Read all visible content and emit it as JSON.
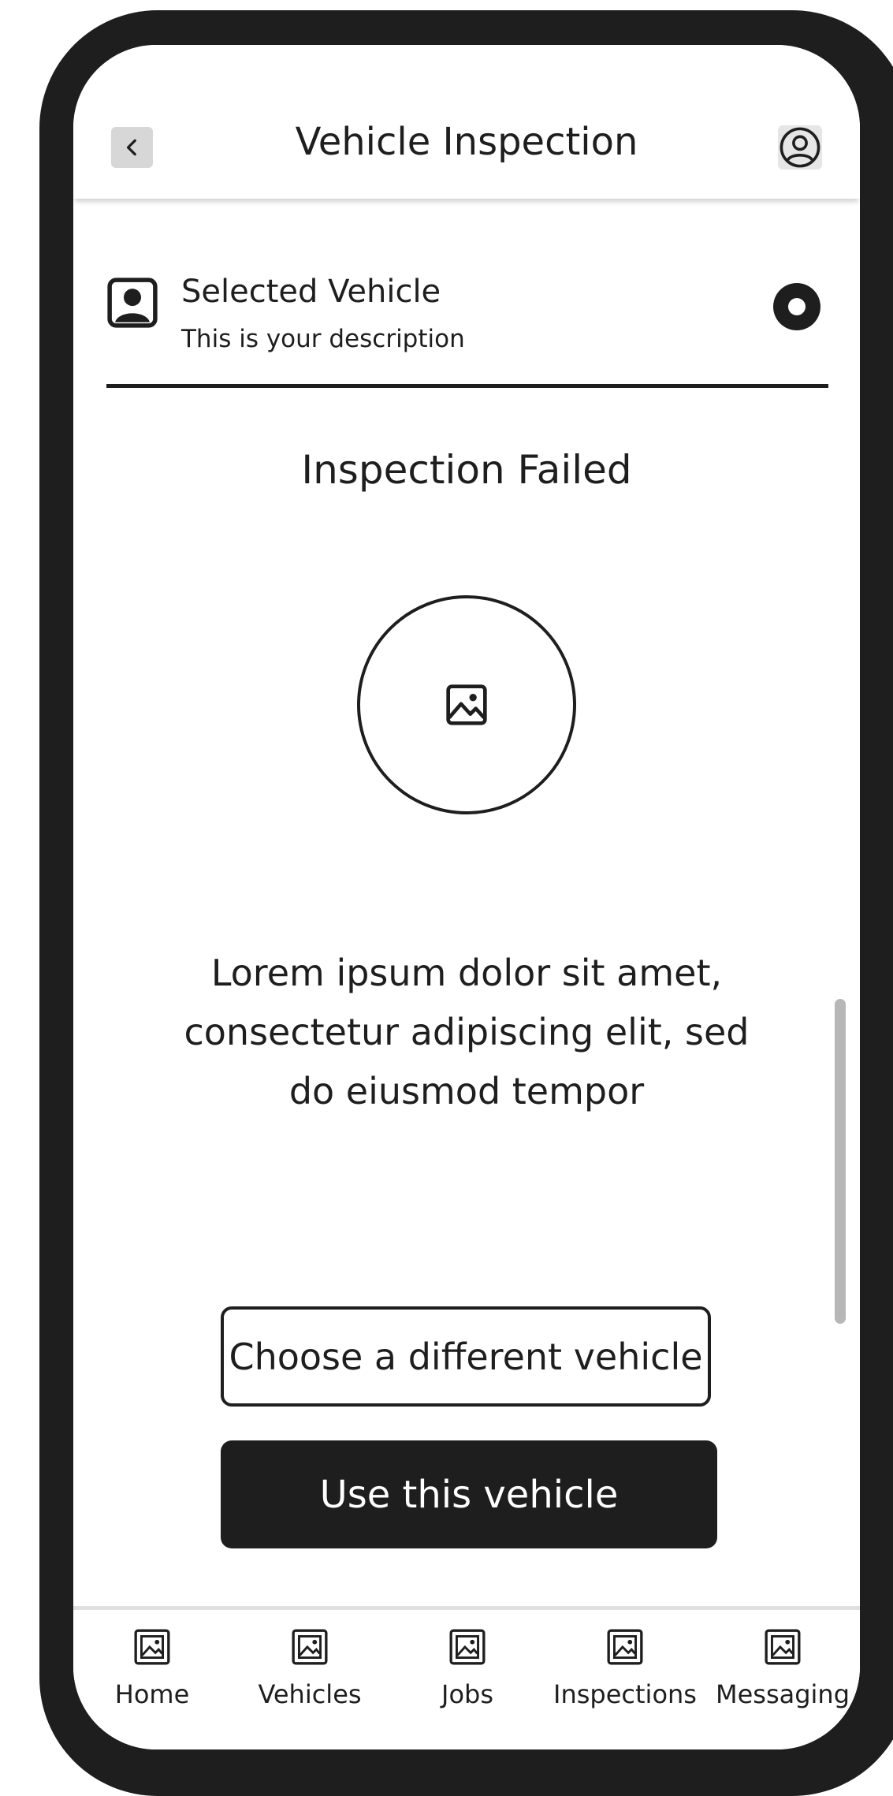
{
  "header": {
    "title": "Vehicle Inspection",
    "back_icon": "chevron-left-icon",
    "profile_icon": "user-circle-icon"
  },
  "vehicle": {
    "title": "Selected Vehicle",
    "description": "This is your description",
    "icon": "avatar-icon",
    "selected": true
  },
  "status": {
    "title": "Inspection Failed",
    "image_icon": "image-icon",
    "message": "Lorem ipsum dolor sit amet, consectetur adipiscing elit, sed do eiusmod tempor"
  },
  "actions": {
    "secondary_label": "Choose a different vehicle",
    "primary_label": "Use this vehicle"
  },
  "nav": {
    "items": [
      {
        "label": "Home",
        "icon": "image-icon"
      },
      {
        "label": "Vehicles",
        "icon": "image-icon"
      },
      {
        "label": "Jobs",
        "icon": "image-icon"
      },
      {
        "label": "Inspections",
        "icon": "image-icon"
      },
      {
        "label": "Messaging",
        "icon": "image-icon"
      }
    ]
  },
  "colors": {
    "frame": "#1e1e1e",
    "primary": "#1e1e1e",
    "muted": "#d7d7d7"
  }
}
